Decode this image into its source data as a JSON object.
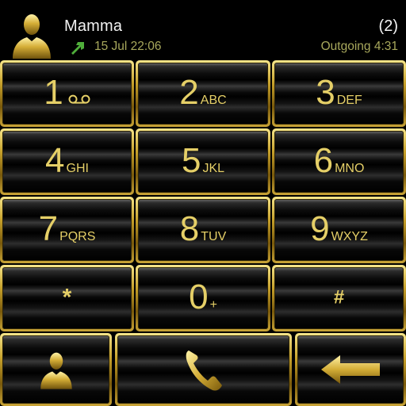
{
  "header": {
    "contact_name": "Mamma",
    "call_count": "(2)",
    "call_date": "15 Jul 22:06",
    "call_info": "Outgoing 4:31",
    "icons": {
      "avatar": "person-silhouette-icon",
      "direction": "outgoing-call-arrow-icon"
    }
  },
  "keypad": {
    "keys": [
      {
        "digit": "1",
        "letters": "",
        "icon": "voicemail-icon"
      },
      {
        "digit": "2",
        "letters": "ABC"
      },
      {
        "digit": "3",
        "letters": "DEF"
      },
      {
        "digit": "4",
        "letters": "GHI"
      },
      {
        "digit": "5",
        "letters": "JKL"
      },
      {
        "digit": "6",
        "letters": "MNO"
      },
      {
        "digit": "7",
        "letters": "PQRS"
      },
      {
        "digit": "8",
        "letters": "TUV"
      },
      {
        "digit": "9",
        "letters": "WXYZ"
      },
      {
        "digit": "*",
        "letters": ""
      },
      {
        "digit": "0",
        "letters": "+"
      },
      {
        "digit": "#",
        "letters": ""
      }
    ]
  },
  "actions": {
    "contacts": "person-icon",
    "call": "phone-handset-icon",
    "backspace": "backspace-arrow-icon"
  },
  "colors": {
    "accent_gold": "#e5cf67",
    "secondary_text": "#a8a85c",
    "call_arrow": "#4fae3a",
    "background": "#000000"
  }
}
